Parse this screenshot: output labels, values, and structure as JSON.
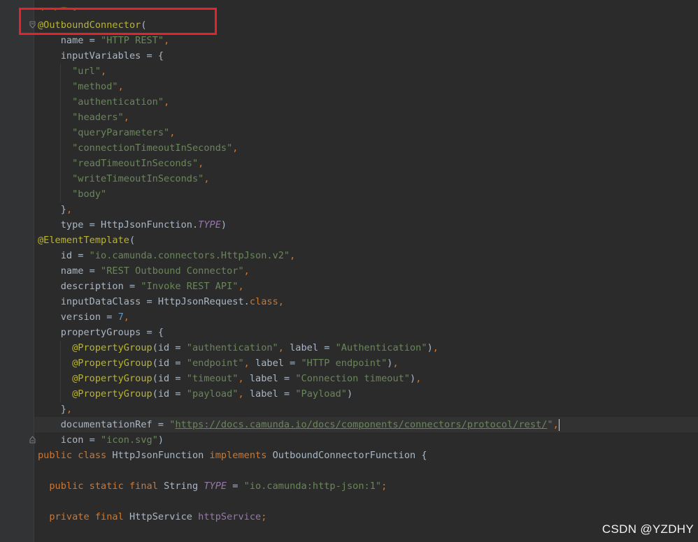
{
  "watermark": "CSDN @YZDHY",
  "colors": {
    "background": "#2b2b2b",
    "annotation": "#bbb529",
    "keyword": "#cc7832",
    "string": "#6a8759",
    "number": "#6897bb",
    "field": "#9876aa",
    "default": "#a9b7c6",
    "highlight_box": "#e8222b"
  },
  "code": {
    "l1": {
      "ann": "@OutboundConnector",
      "t": "("
    },
    "l2": {
      "a": "name = ",
      "s": "\"HTTP REST\"",
      "k": ","
    },
    "l3": {
      "a": "inputVariables = {"
    },
    "l4": {
      "s": "\"url\"",
      "k": ","
    },
    "l5": {
      "s": "\"method\"",
      "k": ","
    },
    "l6": {
      "s": "\"authentication\"",
      "k": ","
    },
    "l7": {
      "s": "\"headers\"",
      "k": ","
    },
    "l8": {
      "s": "\"queryParameters\"",
      "k": ","
    },
    "l9": {
      "s": "\"connectionTimeoutInSeconds\"",
      "k": ","
    },
    "l10": {
      "s": "\"readTimeoutInSeconds\"",
      "k": ","
    },
    "l11": {
      "s": "\"writeTimeoutInSeconds\"",
      "k": ","
    },
    "l12": {
      "s": "\"body\""
    },
    "l13": {
      "a": "}",
      "k": ","
    },
    "l14": {
      "a": "type = HttpJsonFunction.",
      "f": "TYPE",
      "b": ")"
    },
    "l15": {
      "ann": "@ElementTemplate",
      "t": "("
    },
    "l16": {
      "a": "id = ",
      "s": "\"io.camunda.connectors.HttpJson.v2\"",
      "k": ","
    },
    "l17": {
      "a": "name = ",
      "s": "\"REST Outbound Connector\"",
      "k": ","
    },
    "l18": {
      "a": "description = ",
      "s": "\"Invoke REST API\"",
      "k": ","
    },
    "l19": {
      "a": "inputDataClass = HttpJsonRequest.",
      "kw": "class",
      "k": ","
    },
    "l20": {
      "a": "version = ",
      "n": "7",
      "k": ","
    },
    "l21": {
      "a": "propertyGroups = {"
    },
    "l22": {
      "ann": "@PropertyGroup",
      "a": "(id = ",
      "s": "\"authentication\"",
      "k": ",",
      "b": " label = ",
      "s2": "\"Authentication\"",
      "c": ")",
      "k2": ","
    },
    "l23": {
      "ann": "@PropertyGroup",
      "a": "(id = ",
      "s": "\"endpoint\"",
      "k": ",",
      "b": " label = ",
      "s2": "\"HTTP endpoint\"",
      "c": ")",
      "k2": ","
    },
    "l24": {
      "ann": "@PropertyGroup",
      "a": "(id = ",
      "s": "\"timeout\"",
      "k": ",",
      "b": " label = ",
      "s2": "\"Connection timeout\"",
      "c": ")",
      "k2": ","
    },
    "l25": {
      "ann": "@PropertyGroup",
      "a": "(id = ",
      "s": "\"payload\"",
      "k": ",",
      "b": " label = ",
      "s2": "\"Payload\"",
      "c": ")"
    },
    "l26": {
      "a": "}",
      "k": ","
    },
    "l27": {
      "a": "documentationRef = ",
      "s": "\"",
      "url": "https://docs.camunda.io/docs/components/connectors/protocol/rest/",
      "s2": "\"",
      "k": ","
    },
    "l28": {
      "a": "icon = ",
      "s": "\"icon.svg\"",
      "b": ")"
    },
    "l29": {
      "kw": "public class ",
      "a": "HttpJsonFunction ",
      "kw2": "implements ",
      "b": "OutboundConnectorFunction {"
    },
    "l31": {
      "kw": "public static final ",
      "a": "String ",
      "f": "TYPE",
      "b": " = ",
      "s": "\"io.camunda:http-json:1\"",
      "k": ";"
    },
    "l33": {
      "kw": "private final ",
      "a": "HttpService ",
      "fi": "httpService",
      "k": ";"
    }
  }
}
